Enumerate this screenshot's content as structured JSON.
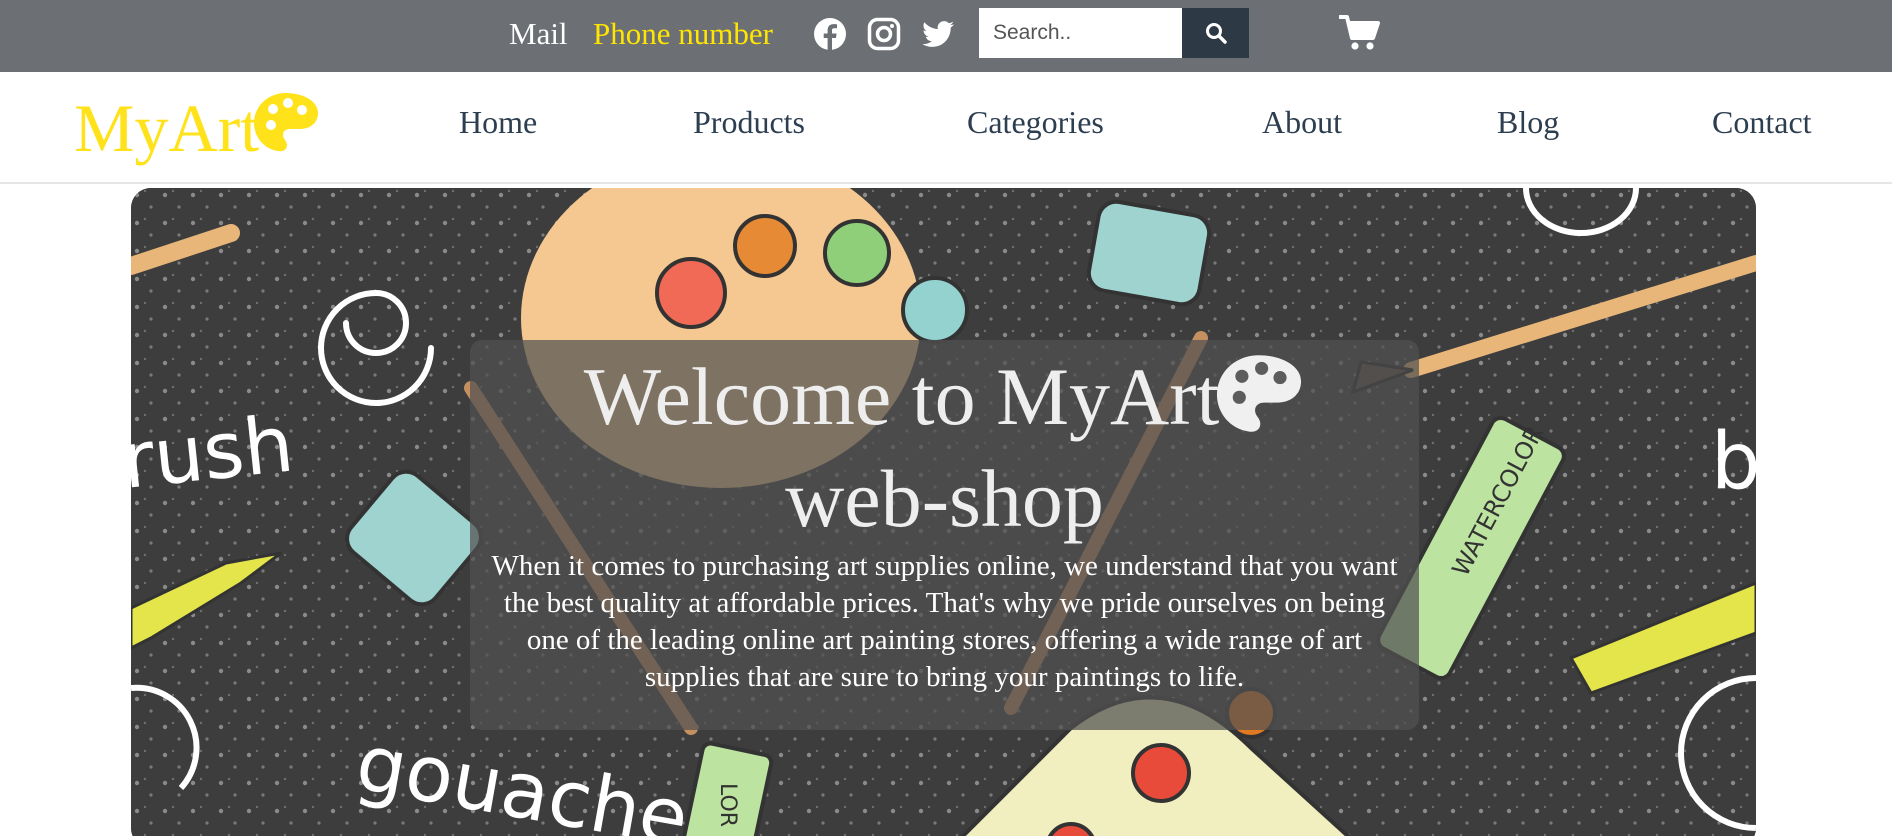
{
  "topbar": {
    "mail_label": "Mail",
    "phone_label": "Phone number",
    "social_icons": [
      "facebook-icon",
      "instagram-icon",
      "twitter-icon"
    ],
    "search": {
      "placeholder": "Search.."
    },
    "search_button_icon": "search-icon",
    "cart_icon": "cart-icon"
  },
  "nav": {
    "logo_text": "MyArt",
    "logo_icon": "palette-icon",
    "items": [
      {
        "label": "Home"
      },
      {
        "label": "Products"
      },
      {
        "label": "Categories"
      },
      {
        "label": "About"
      },
      {
        "label": "Blog"
      },
      {
        "label": "Contact"
      }
    ]
  },
  "hero": {
    "title_line1": "Welcome to MyArt",
    "title_line2": "web-shop",
    "title_icon": "palette-icon",
    "text": "When it comes to purchasing art supplies online, we understand that you want the best quality at affordable prices. That's why we pride ourselves on being one of the leading online art painting stores, offering a wide range of art supplies that are sure to bring your paintings to life.",
    "background_words": [
      "rush",
      "gouache",
      "b",
      "WATERCOLOR",
      "LOR"
    ]
  },
  "colors": {
    "topbar_bg": "#6c6f74",
    "accent_yellow": "#ffe21a",
    "nav_text": "#2d3e50",
    "search_button_bg": "#2d3a46",
    "hero_bg": "#3b3b3b"
  }
}
